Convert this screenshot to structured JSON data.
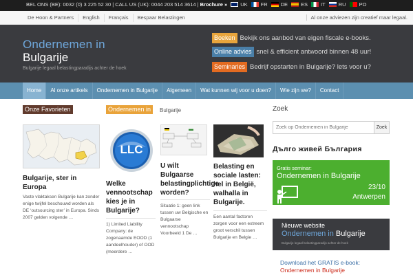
{
  "topbar": {
    "contact": "BEL ONS (BE): 0032 (0) 3 225 52 30 | CALL US (UK): 0044 203 514 3614 |",
    "brochure": "Brochure »",
    "languages": [
      "UK",
      "FR",
      "DE",
      "ES",
      "IT",
      "RU",
      "PO"
    ]
  },
  "subnav": {
    "items": [
      "De Hoon & Partners",
      "English",
      "Français",
      "Bespaar Belastingen"
    ],
    "right": "Al onze adviezen zijn creatief maar legaal."
  },
  "header": {
    "title": "Ondernemen in",
    "subtitle": "Bulgarije",
    "tagline": "Bulgarije legaal belastingparadijs achter de hoek",
    "promos": [
      {
        "tag": "Boeken",
        "text": "Bekijk ons aanbod van eigen fiscale e-books."
      },
      {
        "tag": "Online advies",
        "text": "snel & efficient antwoord binnen 48 uur!"
      },
      {
        "tag": "Seminaries",
        "text": "Bedrijf opstarten in Bulgarije? lets voor u?"
      }
    ]
  },
  "mainnav": {
    "items": [
      "Home",
      "Al onze artikels",
      "Ondernemen in Bulgarije",
      "Algemeen",
      "Wat kunnen wij voor u doen?",
      "Wie zijn we?",
      "Contact"
    ],
    "active": "Home"
  },
  "content": {
    "col1_heading": "Onze Favorieten",
    "col2_heading": "Ondernemen in",
    "col2_heading_rest": "Bulgarije",
    "cards": [
      {
        "title": "Bulgarije, ster in Europa",
        "excerpt": "Vaste vlaktaksen Bulgarije kan zonder enige twijfel beschouwd worden als DE ‘outsourcing ster’ in Europa. Sinds 2007 gelden volgende …"
      },
      {
        "title": "Welke vennootschap kies je in Bulgarije?",
        "excerpt": "1)    Limited Liability Company: de zogenaamde EOOD (1 aandeelhouder) of OOD (meerdere …"
      },
      {
        "title": "U wilt Bulgaarse belastingplichtige worden?",
        "excerpt": "Situatie 1: geen link tussen uw Belgische en Bulgaarse vennootschap Voorbeeld 1 De …"
      },
      {
        "title": "Belasting en sociale lasten: hel in België, walhalla in Bulgarije.",
        "excerpt": "Een aantal factoren zorgen voor een extreem groot verschil tussen Bulgarije en Belgie …"
      }
    ],
    "thumb2_text": "LLC"
  },
  "sidebar": {
    "search_heading": "Zoek",
    "search_placeholder": "Zoek op Ondernemen in Bulgarije",
    "search_button": "Zoek",
    "cyrillic_heading": "Дълго живей България",
    "seminar": {
      "line1": "Gratis seminar:",
      "line2": "Ondernemen in Bulgarije",
      "date": "23/10",
      "city": "Antwerpen"
    },
    "website": {
      "line1": "Nieuwe website",
      "line2a": "Ondernemen in ",
      "line2b": "Bulgarije",
      "line3": "Bulgarije legaal belastingparadijs achter de hoek"
    },
    "download_line1": "Download het GRATIS e-book:",
    "download_line2": "Ondernemen in Bulgarije"
  },
  "colors": {
    "header_bg": "#3a3b3f",
    "nav_bg": "#5c8fb0",
    "accent_blue": "#6fa8dc",
    "tag_orange": "#e8a53c",
    "tag_brown": "#613b2d",
    "seminar_green": "#4caf2f"
  }
}
